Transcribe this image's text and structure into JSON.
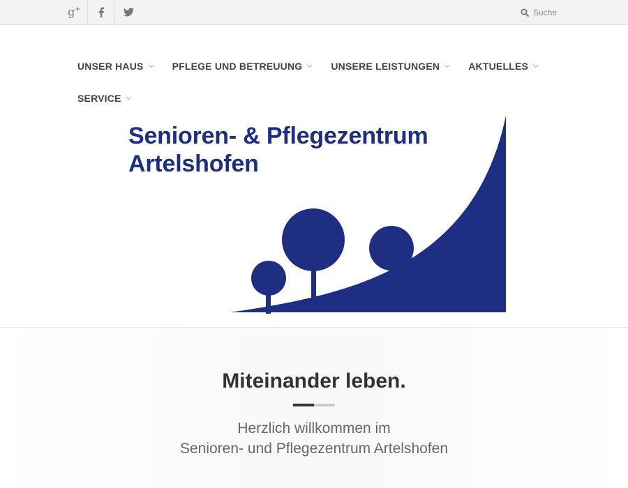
{
  "topbar": {
    "social": [
      {
        "name": "google-plus-icon",
        "glyph": "g+"
      },
      {
        "name": "facebook-icon"
      },
      {
        "name": "twitter-icon"
      }
    ],
    "search": {
      "placeholder": "Suche"
    }
  },
  "nav": {
    "items": [
      {
        "label": "UNSER HAUS"
      },
      {
        "label": "PFLEGE UND BETREUUNG"
      },
      {
        "label": "UNSERE LEISTUNGEN"
      },
      {
        "label": "AKTUELLES"
      },
      {
        "label": "SERVICE"
      }
    ]
  },
  "logo": {
    "line1": "Senioren- & Pflegezentrum",
    "line2": "Artelshofen",
    "color": "#1e2e82"
  },
  "welcome": {
    "headline": "Miteinander leben.",
    "intro_line1": "Herzlich willkommen im",
    "intro_line2": "Senioren- und Pflegezentrum Artelshofen"
  },
  "colors": {
    "topbar_bg": "#f2f2f2",
    "nav_text": "#444444",
    "brand_blue": "#1e2e82",
    "headline": "#333333",
    "intro_text": "#666666"
  }
}
